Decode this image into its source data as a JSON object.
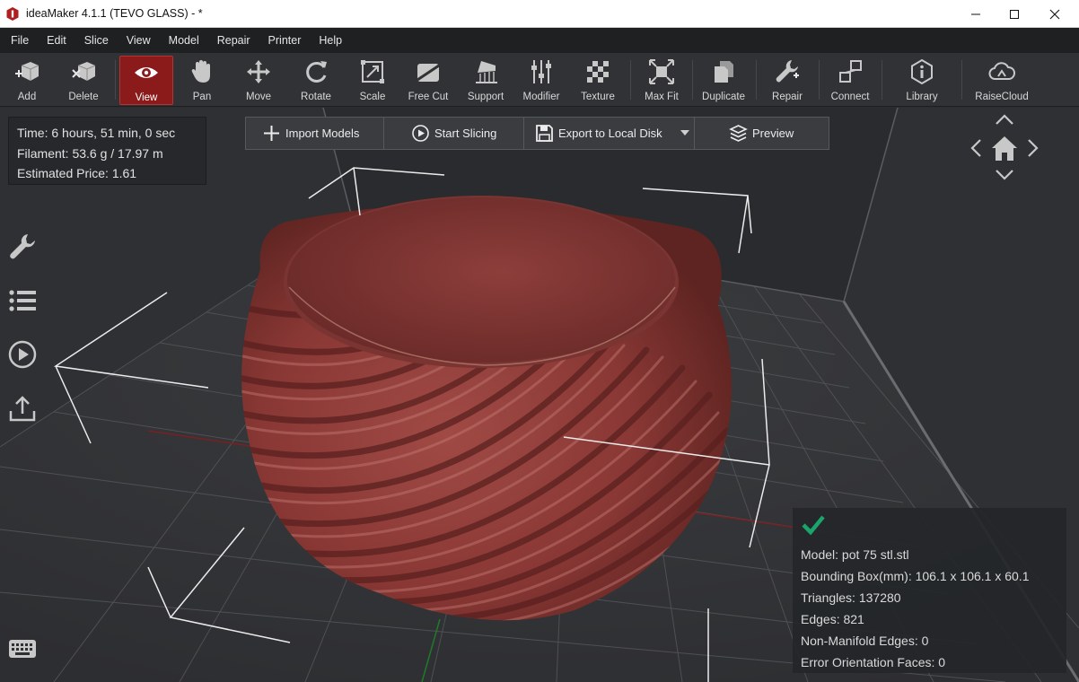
{
  "window": {
    "title": "ideaMaker 4.1.1 (TEVO GLASS) - *",
    "minimize_icon": "minimize-icon",
    "maximize_icon": "maximize-icon",
    "close_icon": "close-icon"
  },
  "menu": [
    "File",
    "Edit",
    "Slice",
    "View",
    "Model",
    "Repair",
    "Printer",
    "Help"
  ],
  "toolbar": {
    "active_tool": "View",
    "tools": [
      {
        "label": "Add",
        "icon": "add-cube-icon"
      },
      {
        "label": "Delete",
        "icon": "delete-cube-icon"
      },
      {
        "label": "View",
        "icon": "eye-icon"
      },
      {
        "label": "Pan",
        "icon": "hand-icon"
      },
      {
        "label": "Move",
        "icon": "move-arrows-icon"
      },
      {
        "label": "Rotate",
        "icon": "rotate-icon"
      },
      {
        "label": "Scale",
        "icon": "scale-icon"
      },
      {
        "label": "Free Cut",
        "icon": "free-cut-icon"
      },
      {
        "label": "Support",
        "icon": "support-icon"
      },
      {
        "label": "Modifier",
        "icon": "modifier-sliders-icon"
      },
      {
        "label": "Texture",
        "icon": "texture-checker-icon"
      },
      {
        "label": "Max Fit",
        "icon": "max-fit-icon"
      },
      {
        "label": "Duplicate",
        "icon": "duplicate-icon"
      },
      {
        "label": "Repair",
        "icon": "wrench-icon"
      },
      {
        "label": "Connect",
        "icon": "connect-icon"
      },
      {
        "label": "Library",
        "icon": "info-library-icon"
      },
      {
        "label": "RaiseCloud",
        "icon": "cloud-icon"
      }
    ]
  },
  "print_info": {
    "time": "Time: 6 hours, 51 min, 0 sec",
    "filament": "Filament: 53.6 g / 17.97 m",
    "price": "Estimated Price: 1.61"
  },
  "actions": {
    "import": "Import Models",
    "start_slicing": "Start Slicing",
    "export": "Export to Local Disk",
    "preview": "Preview"
  },
  "sidebar_icons": [
    "wrench-icon",
    "list-icon",
    "play-circle-icon",
    "upload-icon",
    "keyboard-icon"
  ],
  "nav_icons": [
    "home-icon",
    "arrow-up-icon",
    "arrow-down-icon",
    "arrow-left-icon",
    "arrow-right-icon"
  ],
  "model_info": {
    "model": "Model: pot 75 stl.stl",
    "bounding_box": "Bounding Box(mm): 106.1 x 106.1 x 60.1",
    "triangles": "Triangles: 137280",
    "edges": "Edges: 821",
    "non_manifold": "Non-Manifold Edges: 0",
    "error_faces": "Error Orientation Faces: 0",
    "status_icon": "check-icon"
  },
  "colors": {
    "accent_active": "#8b1b1b",
    "model": "#8c3b38",
    "check": "#19a56b"
  }
}
